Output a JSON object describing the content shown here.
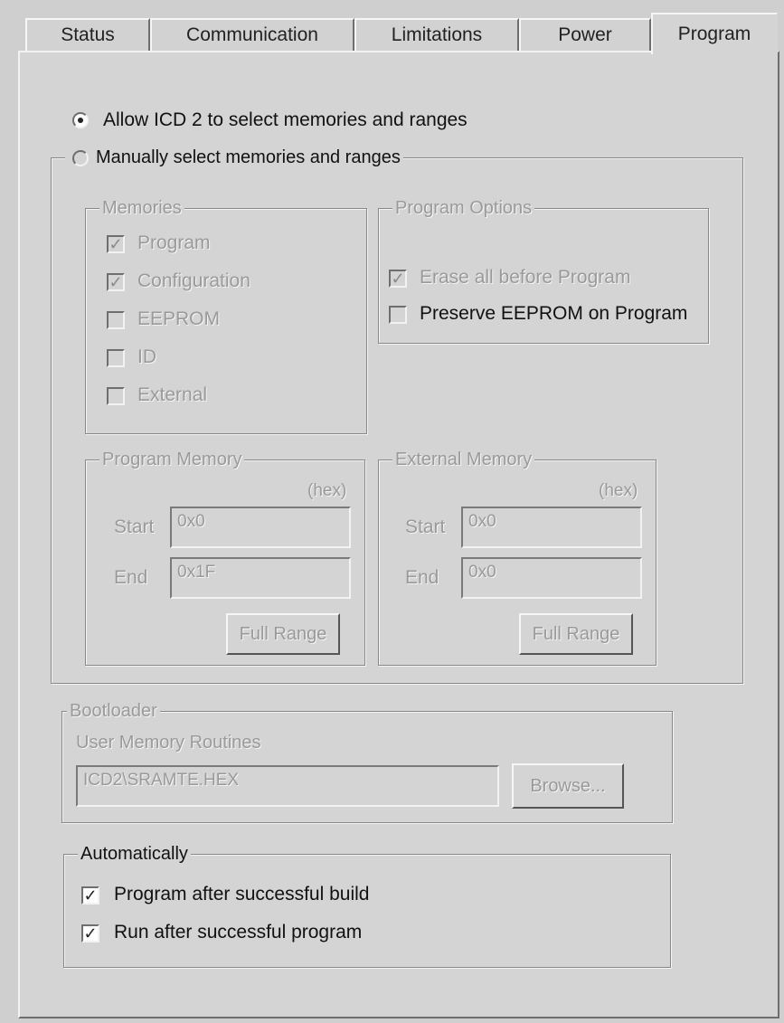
{
  "tabs": [
    {
      "label": "Status"
    },
    {
      "label": "Communication"
    },
    {
      "label": "Limitations"
    },
    {
      "label": "Power"
    },
    {
      "label": "Program"
    }
  ],
  "mode": {
    "auto_label": "Allow ICD 2 to select memories and ranges",
    "manual_label": "Manually select memories and ranges",
    "selected": "auto"
  },
  "memories": {
    "title": "Memories",
    "items": [
      {
        "label": "Program",
        "checked": true
      },
      {
        "label": "Configuration",
        "checked": true
      },
      {
        "label": "EEPROM",
        "checked": false
      },
      {
        "label": "ID",
        "checked": false
      },
      {
        "label": "External",
        "checked": false
      }
    ]
  },
  "program_options": {
    "title": "Program Options",
    "erase_label": "Erase all before Program",
    "preserve_label": "Preserve EEPROM on Program"
  },
  "program_memory": {
    "title": "Program Memory",
    "hex": "(hex)",
    "start_label": "Start",
    "start_value": "0x0",
    "end_label": "End",
    "end_value": "0x1F",
    "full_range": "Full Range"
  },
  "external_memory": {
    "title": "External Memory",
    "hex": "(hex)",
    "start_label": "Start",
    "start_value": "0x0",
    "end_label": "End",
    "end_value": "0x0",
    "full_range": "Full Range"
  },
  "bootloader": {
    "title": "Bootloader",
    "routines_label": "User Memory Routines",
    "path_value": "ICD2\\SRAMTE.HEX",
    "browse": "Browse..."
  },
  "automatically": {
    "title": "Automatically",
    "program_after_build": "Program after successful build",
    "run_after_program": "Run after successful program"
  }
}
